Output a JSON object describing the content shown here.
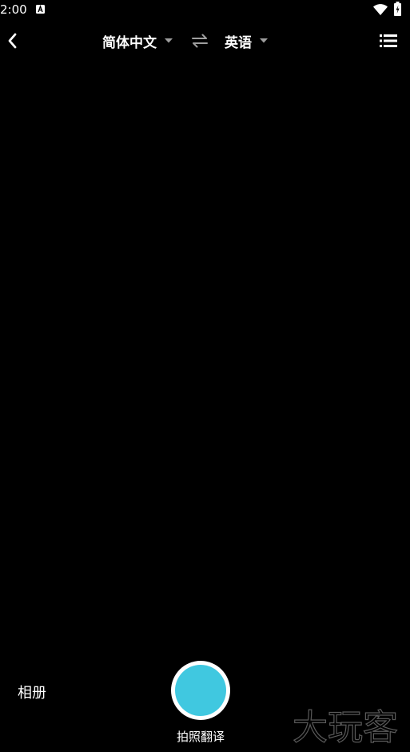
{
  "status_bar": {
    "time": "2:00",
    "icons": [
      "notification-a-icon",
      "wifi-icon",
      "battery-icon"
    ]
  },
  "header": {
    "back_icon": "chevron-left-icon",
    "source_language": "简体中文",
    "target_language": "英语",
    "swap_icon": "swap-arrows-icon",
    "menu_icon": "list-menu-icon"
  },
  "bottom": {
    "album_label": "相册",
    "capture_label": "拍照翻译"
  },
  "watermark": {
    "text": "大玩客"
  },
  "colors": {
    "background": "#000000",
    "foreground": "#ffffff",
    "shutter_accent": "#40c8e0",
    "caret": "#9e9e9e"
  }
}
